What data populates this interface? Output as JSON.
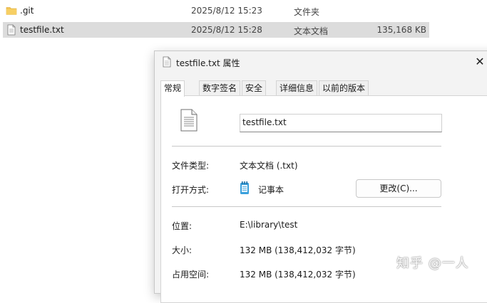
{
  "explorer": {
    "rows": [
      {
        "name": ".git",
        "date": "2025/8/12 15:23",
        "type": "文件夹",
        "size": "",
        "icon": "folder-icon"
      },
      {
        "name": "testfile.txt",
        "date": "2025/8/12 15:28",
        "type": "文本文档",
        "size": "135,168 KB",
        "icon": "text-file-icon"
      }
    ]
  },
  "dialog": {
    "title": "testfile.txt 属性",
    "close_glyph": "✕",
    "tabs": [
      "常规",
      "数字签名",
      "安全",
      "详细信息",
      "以前的版本"
    ],
    "active_tab": "常规",
    "file_name": "testfile.txt",
    "file_type_label": "文件类型:",
    "file_type_value": "文本文档 (.txt)",
    "opens_with_label": "打开方式:",
    "opens_with_value": "记事本",
    "change_button": "更改(C)...",
    "location_label": "位置:",
    "location_value": "E:\\library\\test",
    "size_label": "大小:",
    "size_value": "132 MB (138,412,032 字节)",
    "size_on_disk_label": "占用空间:",
    "size_on_disk_value": "132 MB (138,412,032 字节)"
  },
  "watermark": "知乎 @一人",
  "colors": {
    "selected_row": "#dcdcdc",
    "dialog_bg": "#f3f3f3",
    "folder": "#f2c14e",
    "notepad": "#3aa0dc"
  }
}
